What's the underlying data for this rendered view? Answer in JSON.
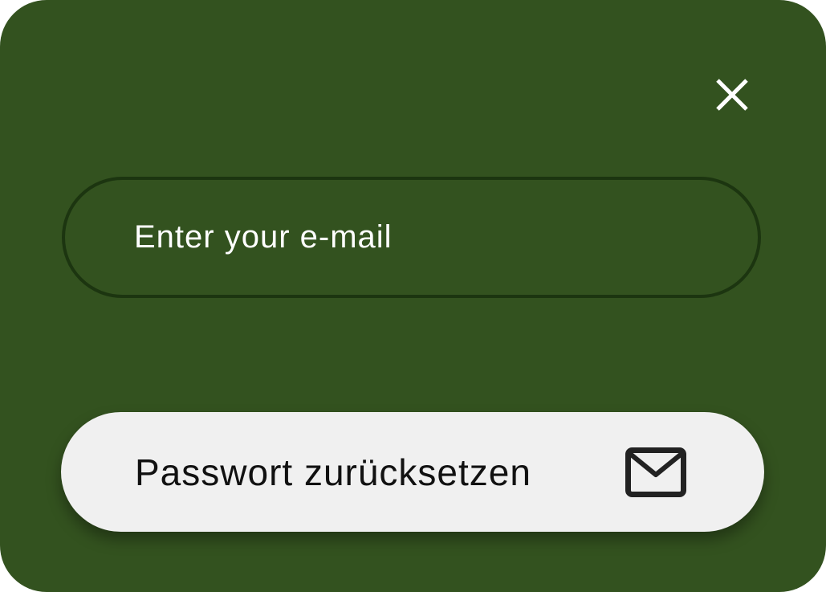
{
  "dialog": {
    "background_color": "#33521F",
    "close_icon": "close-icon"
  },
  "email": {
    "value": "",
    "placeholder": "Enter your e-mail",
    "border_color": "#1C3510"
  },
  "reset_button": {
    "label": "Passwort zurücksetzen",
    "icon": "mail-icon",
    "background_color": "#F0F0F0"
  }
}
